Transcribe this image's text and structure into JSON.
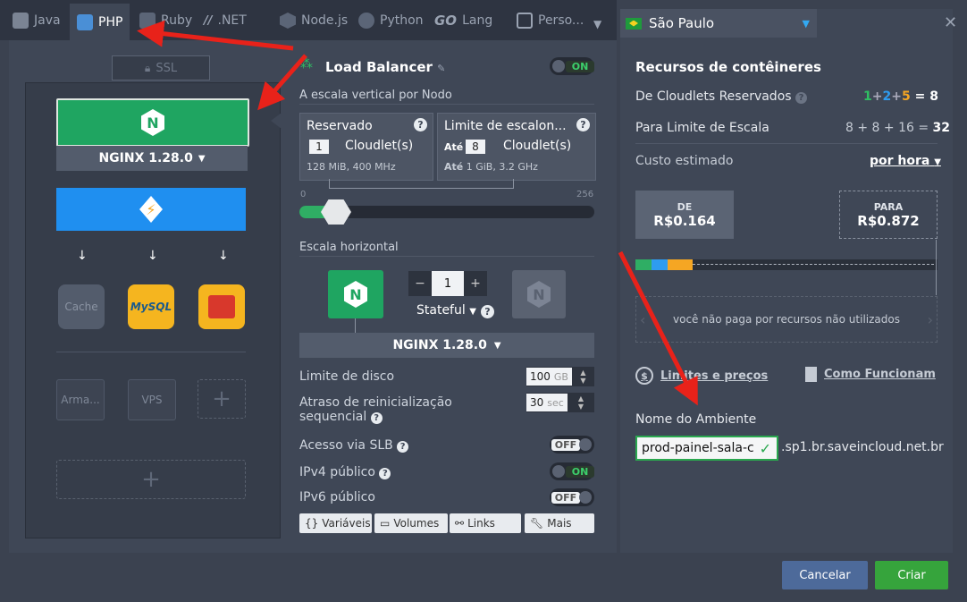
{
  "tabs": [
    {
      "label": "Java",
      "icon": "java-icon"
    },
    {
      "label": "PHP",
      "icon": "php-icon",
      "active": true
    },
    {
      "label": "Ruby",
      "icon": "ruby-icon"
    },
    {
      "label": ".NET",
      "icon": "dotnet-icon"
    },
    {
      "label": "Node.js",
      "icon": "nodejs-icon"
    },
    {
      "label": "Python",
      "icon": "python-icon"
    },
    {
      "label": "Lang",
      "icon": "go-icon",
      "prefix": "GO"
    },
    {
      "label": "Perso...",
      "icon": "custom-icon"
    }
  ],
  "region": {
    "label": "São Paulo",
    "flag": "brazil-flag-icon"
  },
  "topology": {
    "ssl_label": "SSL",
    "nginx_version": "NGINX 1.28.0",
    "db_cache": "Cache",
    "db_mysql": "MySQL",
    "storage_label": "Arma...",
    "vps_label": "VPS",
    "add": "+"
  },
  "balancer": {
    "title": "Load Balancer",
    "toggle": "ON",
    "vertical_title": "A escala vertical por Nodo",
    "reserved_title": "Reservado",
    "reserved_value": "1",
    "cloudlets_label": "Cloudlet(s)",
    "reserved_spec": "128 MiB, 400 MHz",
    "limit_title": "Limite de escalon...",
    "limit_prefix": "Até",
    "limit_value": "8",
    "limit_spec_prefix": "Até",
    "limit_spec": "1 GiB, 3.2 GHz",
    "slider_min": "0",
    "slider_max": "256",
    "horizontal_title": "Escala horizontal",
    "node_count": "1",
    "stateful_label": "Stateful",
    "nginx_version": "NGINX 1.28.0",
    "disk_label": "Limite de disco",
    "disk_value": "100",
    "disk_unit": "GB",
    "restart_label_1": "Atraso de reinicialização",
    "restart_label_2": "sequencial",
    "restart_value": "30",
    "restart_unit": "sec",
    "slb_label": "Acesso via SLB",
    "slb_toggle": "OFF",
    "ipv4_label": "IPv4 público",
    "ipv4_toggle": "ON",
    "ipv6_label": "IPv6 público",
    "ipv6_toggle": "OFF",
    "footer": [
      "Variáveis",
      "Volumes",
      "Links",
      "Mais"
    ]
  },
  "resources": {
    "title": "Recursos de contêineres",
    "reserved_label": "De Cloudlets Reservados",
    "reserved_parts": [
      "1",
      "+",
      "2",
      "+",
      "5",
      "=",
      "8"
    ],
    "scale_label": "Para Limite de Escala",
    "scale_formula": "8 + 8 + 16 =",
    "scale_total": "32",
    "cost_label": "Custo estimado",
    "cost_period": "por hora",
    "from_label": "DE",
    "from_price": "R$0.164",
    "to_label": "PARA",
    "to_price": "R$0.872",
    "note": "você não paga por recursos não utilizados",
    "limits_link": "Limites e preços",
    "how_link": "Como Funcionam",
    "env_title": "Nome do Ambiente",
    "env_value": "prod-painel-sala-c",
    "env_suffix": ".sp1.br.saveincloud.net.br"
  },
  "actions": {
    "cancel": "Cancelar",
    "create": "Criar"
  },
  "colors": {
    "green": "#2aa84f",
    "blue": "#1f8ff0",
    "orange": "#f5a623",
    "red_annotation": "#e8221a"
  }
}
